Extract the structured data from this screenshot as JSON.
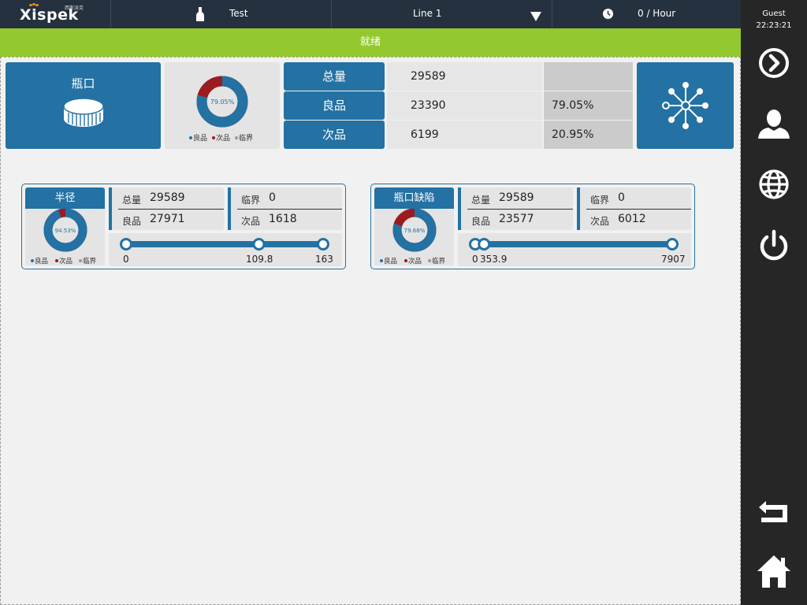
{
  "header": {
    "brand": "Xispek",
    "brand_cn": "西斯派克",
    "product": "Test",
    "line": "Line 1",
    "rate": "0 / Hour",
    "icons": {
      "product": "bottle-icon",
      "line": "dropdown-arrow-icon",
      "rate": "clock-icon"
    }
  },
  "status": {
    "text": "就绪",
    "color": "#93c82f"
  },
  "summary": {
    "title": "瓶口",
    "donut": {
      "percent_label": "79.05%",
      "good_pct": 79.05
    },
    "legend": [
      "良品",
      "次品",
      "临界"
    ],
    "rows": [
      {
        "label": "总量",
        "value": "29589",
        "percent": ""
      },
      {
        "label": "良品",
        "value": "23390",
        "percent": "79.05%"
      },
      {
        "label": "次品",
        "value": "6199",
        "percent": "20.95%"
      }
    ]
  },
  "detectors": [
    {
      "title": "半径",
      "donut": {
        "percent_label": "94.53%",
        "good_pct": 94.53
      },
      "legend": [
        "良品",
        "次品",
        "临界"
      ],
      "total_label": "总量",
      "total": "29589",
      "good_label": "良品",
      "good": "27971",
      "critical_label": "临界",
      "critical": "0",
      "bad_label": "次品",
      "bad": "1618",
      "slider": {
        "min": "0",
        "mid": "109.8",
        "max": "163",
        "low_fraction": 0.0,
        "high_fraction": 0.674
      }
    },
    {
      "title": "瓶口缺陷",
      "donut": {
        "percent_label": "79.68%",
        "good_pct": 79.68
      },
      "legend": [
        "良品",
        "次品",
        "临界"
      ],
      "total_label": "总量",
      "total": "29589",
      "good_label": "良品",
      "good": "23577",
      "critical_label": "临界",
      "critical": "0",
      "bad_label": "次品",
      "bad": "6012",
      "slider": {
        "min": "0",
        "mid": "353.9",
        "max": "7907",
        "low_fraction": 0.0,
        "high_fraction": 0.045
      }
    }
  ],
  "sidebar": {
    "user": "Guest",
    "time": "22:23:21",
    "buttons": [
      "next-icon",
      "user-icon",
      "globe-icon",
      "power-icon",
      "back-icon",
      "home-icon"
    ]
  },
  "colors": {
    "primary": "#2471a3",
    "defect": "#9b1b1f",
    "critical": "#999999",
    "topbar": "#25313e",
    "sidebar": "#262626"
  }
}
